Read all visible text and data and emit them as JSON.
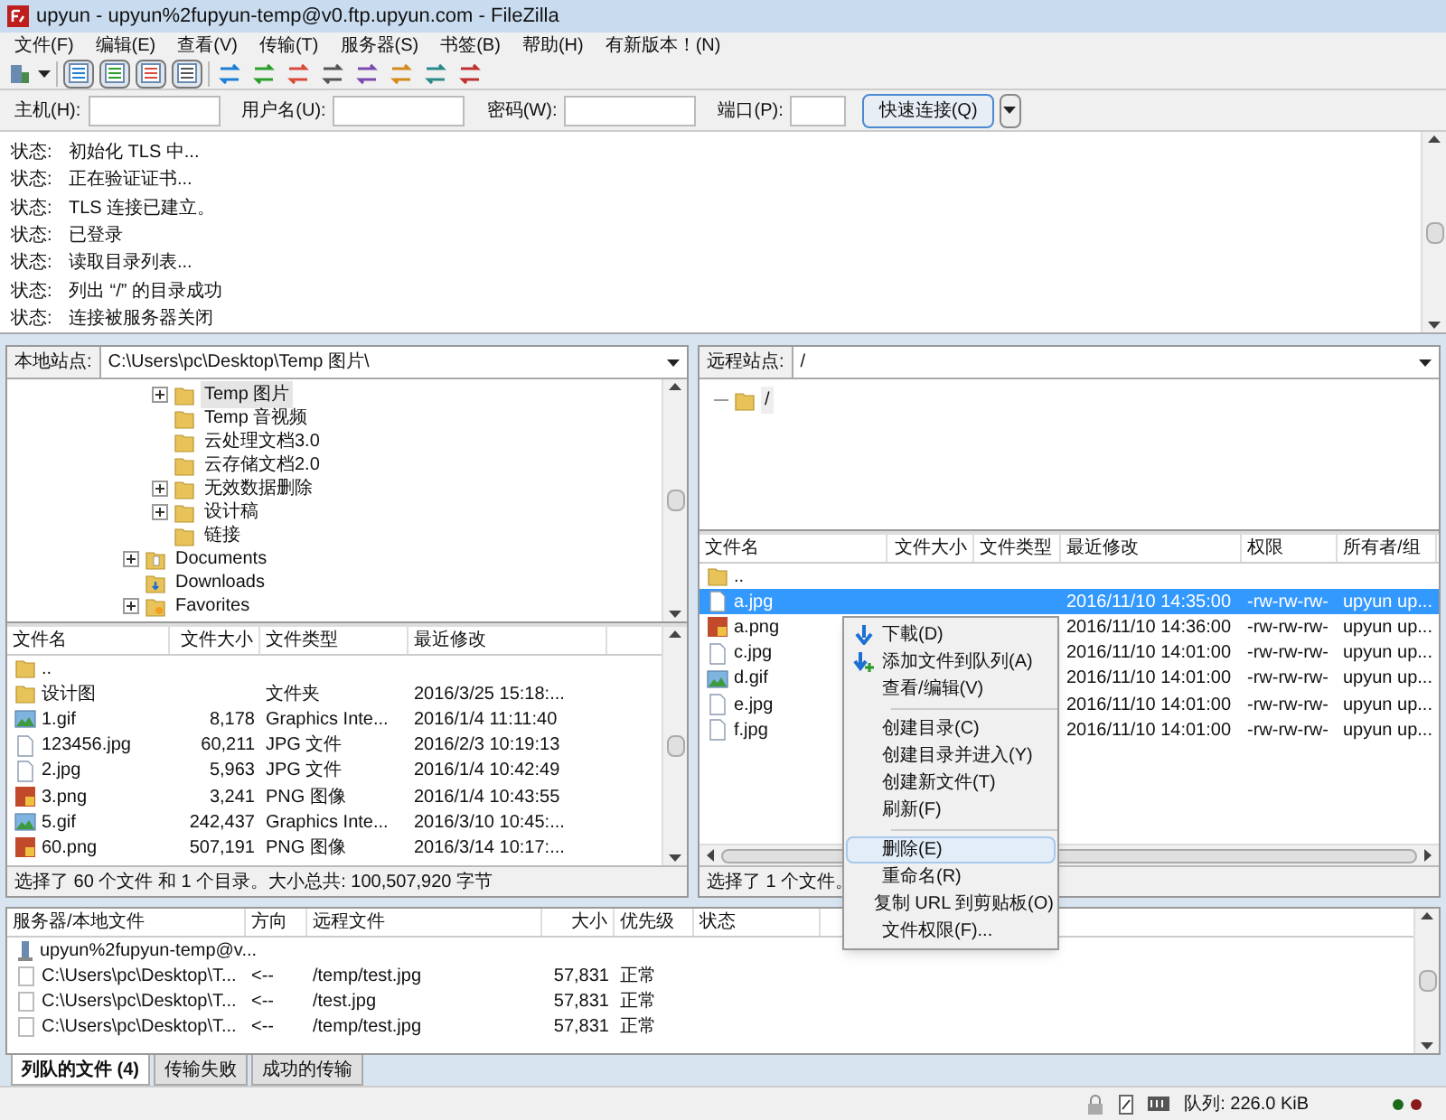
{
  "window": {
    "title": "upyun - upyun%2fupyun-temp@v0.ftp.upyun.com - FileZilla"
  },
  "menu": [
    "文件(F)",
    "编辑(E)",
    "查看(V)",
    "传输(T)",
    "服务器(S)",
    "书签(B)",
    "帮助(H)",
    "有新版本！(N)"
  ],
  "toolbar": {
    "toggles": [
      {
        "on": true
      },
      {
        "on": true
      },
      {
        "on": true
      },
      {
        "on": true
      }
    ]
  },
  "quickconnect": {
    "host": "主机(H):",
    "user": "用户名(U):",
    "password": "密码(W):",
    "port": "端口(P):",
    "button": "快速连接(Q)"
  },
  "log": [
    {
      "label": "状态:",
      "text": "初始化 TLS 中..."
    },
    {
      "label": "状态:",
      "text": "正在验证证书..."
    },
    {
      "label": "状态:",
      "text": "TLS 连接已建立。"
    },
    {
      "label": "状态:",
      "text": "已登录"
    },
    {
      "label": "状态:",
      "text": "读取目录列表..."
    },
    {
      "label": "状态:",
      "text": "列出 “/” 的目录成功"
    },
    {
      "label": "状态:",
      "text": "连接被服务器关闭"
    }
  ],
  "local": {
    "site_label": "本地站点:",
    "path": "C:\\Users\\pc\\Desktop\\Temp 图片\\",
    "tree": [
      {
        "name": "Temp 图片",
        "kind": "folder",
        "expanded": false,
        "selected": true
      },
      {
        "name": "Temp 音视频",
        "kind": "folder",
        "selected": false
      },
      {
        "name": "云处理文档3.0",
        "kind": "folder",
        "selected": false
      },
      {
        "name": "云存储文档2.0",
        "kind": "folder",
        "selected": false
      },
      {
        "name": "无效数据删除",
        "kind": "folder",
        "expanded": false,
        "selected": false
      },
      {
        "name": "设计稿",
        "kind": "folder",
        "expanded": false,
        "selected": false
      },
      {
        "name": "链接",
        "kind": "folder",
        "selected": false
      }
    ],
    "tree_parent": [
      {
        "name": "Documents",
        "kind": "documents",
        "expanded": false
      },
      {
        "name": "Downloads",
        "kind": "downloads"
      },
      {
        "name": "Favorites",
        "kind": "favorites",
        "expanded": false
      }
    ],
    "columns": [
      "文件名",
      "文件大小",
      "文件类型",
      "最近修改"
    ],
    "rows": [
      {
        "name": "..",
        "kind": "folder"
      },
      {
        "name": "设计图",
        "kind": "folder",
        "type": "文件夹",
        "modified": "2016/3/25 15:18:..."
      },
      {
        "name": "1.gif",
        "kind": "gif",
        "size": "8,178",
        "type": "Graphics Inte...",
        "modified": "2016/1/4 11:11:40"
      },
      {
        "name": "123456.jpg",
        "kind": "file",
        "size": "60,211",
        "type": "JPG 文件",
        "modified": "2016/2/3 10:19:13"
      },
      {
        "name": "2.jpg",
        "kind": "file",
        "size": "5,963",
        "type": "JPG 文件",
        "modified": "2016/1/4 10:42:49"
      },
      {
        "name": "3.png",
        "kind": "png",
        "size": "3,241",
        "type": "PNG 图像",
        "modified": "2016/1/4 10:43:55"
      },
      {
        "name": "5.gif",
        "kind": "gif",
        "size": "242,437",
        "type": "Graphics Inte...",
        "modified": "2016/3/10 10:45:..."
      },
      {
        "name": "60.png",
        "kind": "png",
        "size": "507,191",
        "type": "PNG 图像",
        "modified": "2016/3/14 10:17:..."
      }
    ],
    "status": "选择了 60 个文件 和 1 个目录。大小总共: 100,507,920 字节"
  },
  "remote": {
    "site_label": "远程站点:",
    "path": "/",
    "tree": [
      {
        "name": "/",
        "kind": "folder"
      }
    ],
    "columns": [
      "文件名",
      "文件大小",
      "文件类型",
      "最近修改",
      "权限",
      "所有者/组"
    ],
    "rows": [
      {
        "name": "..",
        "kind": "folder",
        "selected": false
      },
      {
        "name": "a.jpg",
        "kind": "file",
        "selected": true,
        "modified": "2016/11/10 14:35:00",
        "perms": "-rw-rw-rw-",
        "owner": "upyun up..."
      },
      {
        "name": "a.png",
        "kind": "png",
        "selected": false,
        "modified": "2016/11/10 14:36:00",
        "perms": "-rw-rw-rw-",
        "owner": "upyun up..."
      },
      {
        "name": "c.jpg",
        "kind": "file",
        "selected": false,
        "modified": "2016/11/10 14:01:00",
        "perms": "-rw-rw-rw-",
        "owner": "upyun up..."
      },
      {
        "name": "d.gif",
        "kind": "gif",
        "selected": false,
        "modified": "2016/11/10 14:01:00",
        "perms": "-rw-rw-rw-",
        "owner": "upyun up..."
      },
      {
        "name": "e.jpg",
        "kind": "file",
        "selected": false,
        "modified": "2016/11/10 14:01:00",
        "perms": "-rw-rw-rw-",
        "owner": "upyun up..."
      },
      {
        "name": "f.jpg",
        "kind": "file",
        "selected": false,
        "modified": "2016/11/10 14:01:00",
        "perms": "-rw-rw-rw-",
        "owner": "upyun up..."
      }
    ],
    "status": "选择了 1 个文件。"
  },
  "context_menu": [
    {
      "kind": "download",
      "label": "下載(D)",
      "selected": false
    },
    {
      "kind": "enqueue",
      "label": "添加文件到队列(A)",
      "selected": false
    },
    {
      "kind": "item",
      "label": "查看/编辑(V)",
      "selected": false
    },
    {
      "kind": "separator"
    },
    {
      "kind": "item",
      "label": "创建目录(C)",
      "selected": false
    },
    {
      "kind": "item",
      "label": "创建目录并进入(Y)",
      "selected": false
    },
    {
      "kind": "item",
      "label": "创建新文件(T)",
      "selected": false
    },
    {
      "kind": "item",
      "label": "刷新(F)",
      "selected": false
    },
    {
      "kind": "separator"
    },
    {
      "kind": "item",
      "label": "删除(E)",
      "selected": true
    },
    {
      "kind": "item",
      "label": "重命名(R)",
      "selected": false
    },
    {
      "kind": "item",
      "label": "复制 URL 到剪贴板(O)",
      "selected": false
    },
    {
      "kind": "item",
      "label": "文件权限(F)...",
      "selected": false
    }
  ],
  "queue": {
    "columns": [
      "服务器/本地文件",
      "方向",
      "远程文件",
      "大小",
      "优先级",
      "状态"
    ],
    "server": "upyun%2fupyun-temp@v...",
    "rows": [
      {
        "local": "C:\\Users\\pc\\Desktop\\T...",
        "direction": "<--",
        "remote": "/temp/test.jpg",
        "size": "57,831",
        "priority": "正常"
      },
      {
        "local": "C:\\Users\\pc\\Desktop\\T...",
        "direction": "<--",
        "remote": "/test.jpg",
        "size": "57,831",
        "priority": "正常"
      },
      {
        "local": "C:\\Users\\pc\\Desktop\\T...",
        "direction": "<--",
        "remote": "/temp/test.jpg",
        "size": "57,831",
        "priority": "正常"
      }
    ],
    "tabs": [
      {
        "label": "列队的文件 (4)",
        "selected": true
      },
      {
        "label": "传输失败",
        "selected": false
      },
      {
        "label": "成功的传输",
        "selected": false
      }
    ]
  },
  "status_bar": {
    "queue": "队列: 226.0 KiB"
  }
}
